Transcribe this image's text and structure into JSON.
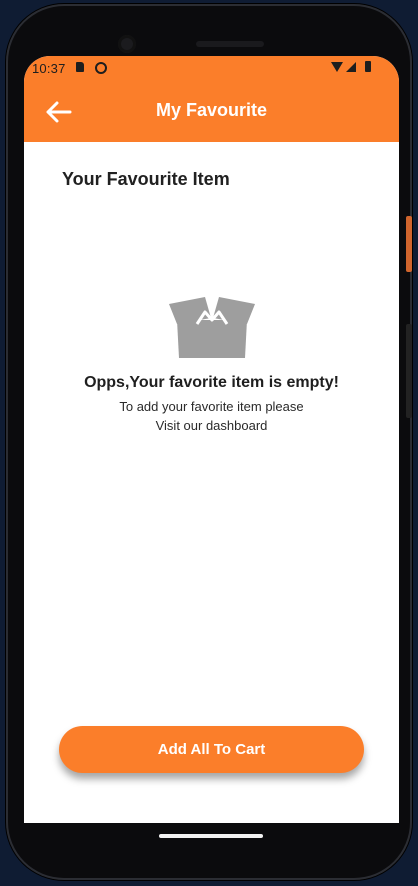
{
  "status_bar": {
    "time": "10:37"
  },
  "app_bar": {
    "title": "My Favourite",
    "back_icon": "arrow-left-icon"
  },
  "content": {
    "section_title": "Your Favourite Item",
    "empty_state": {
      "icon": "open-box-icon",
      "title": "Opps,Your favorite item is empty!",
      "line1": "To add your favorite item please",
      "line2": "Visit our dashboard"
    }
  },
  "actions": {
    "add_all_label": "Add All To Cart"
  },
  "colors": {
    "accent": "#fb7e2a",
    "background": "#ffffff",
    "frame": "#0f1c33",
    "empty_icon": "#9e9e9e"
  }
}
